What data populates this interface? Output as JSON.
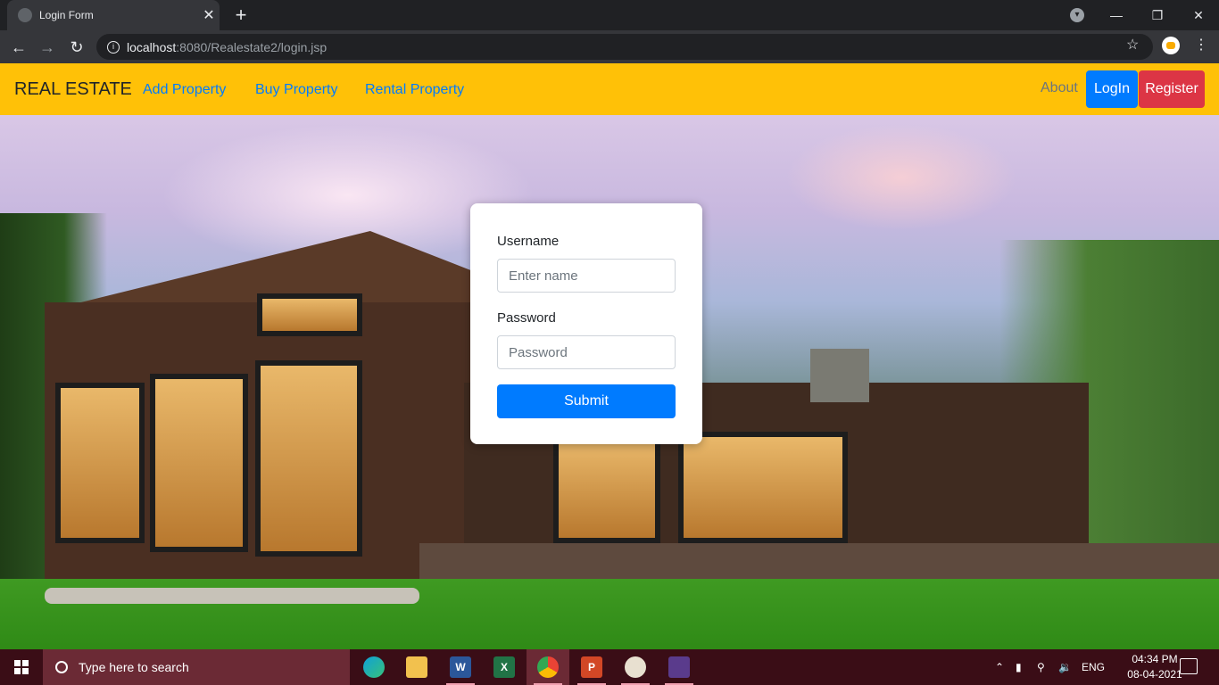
{
  "browser": {
    "tab_title": "Login Form",
    "tab_close": "✕",
    "new_tab": "+",
    "url_host": "localhost",
    "url_path": ":8080/Realestate2/login.jsp"
  },
  "navbar": {
    "brand": "REAL ESTATE",
    "links": [
      "Add Property",
      "Buy Property",
      "Rental Property"
    ],
    "about": "About",
    "login": "LogIn",
    "register": "Register",
    "colors": {
      "bar": "#ffc107",
      "link": "#007bff",
      "login": "#007bff",
      "register": "#dc3545"
    }
  },
  "login_form": {
    "username_label": "Username",
    "username_placeholder": "Enter name",
    "password_label": "Password",
    "password_placeholder": "Password",
    "submit_label": "Submit"
  },
  "taskbar": {
    "search_placeholder": "Type here to search",
    "apps": [
      "edge-icon",
      "file-explorer-icon",
      "word-icon",
      "excel-icon",
      "chrome-icon",
      "powerpoint-icon",
      "paint-icon",
      "app-icon"
    ],
    "language": "ENG",
    "time": "04:34 PM",
    "date": "08-04-2021"
  }
}
